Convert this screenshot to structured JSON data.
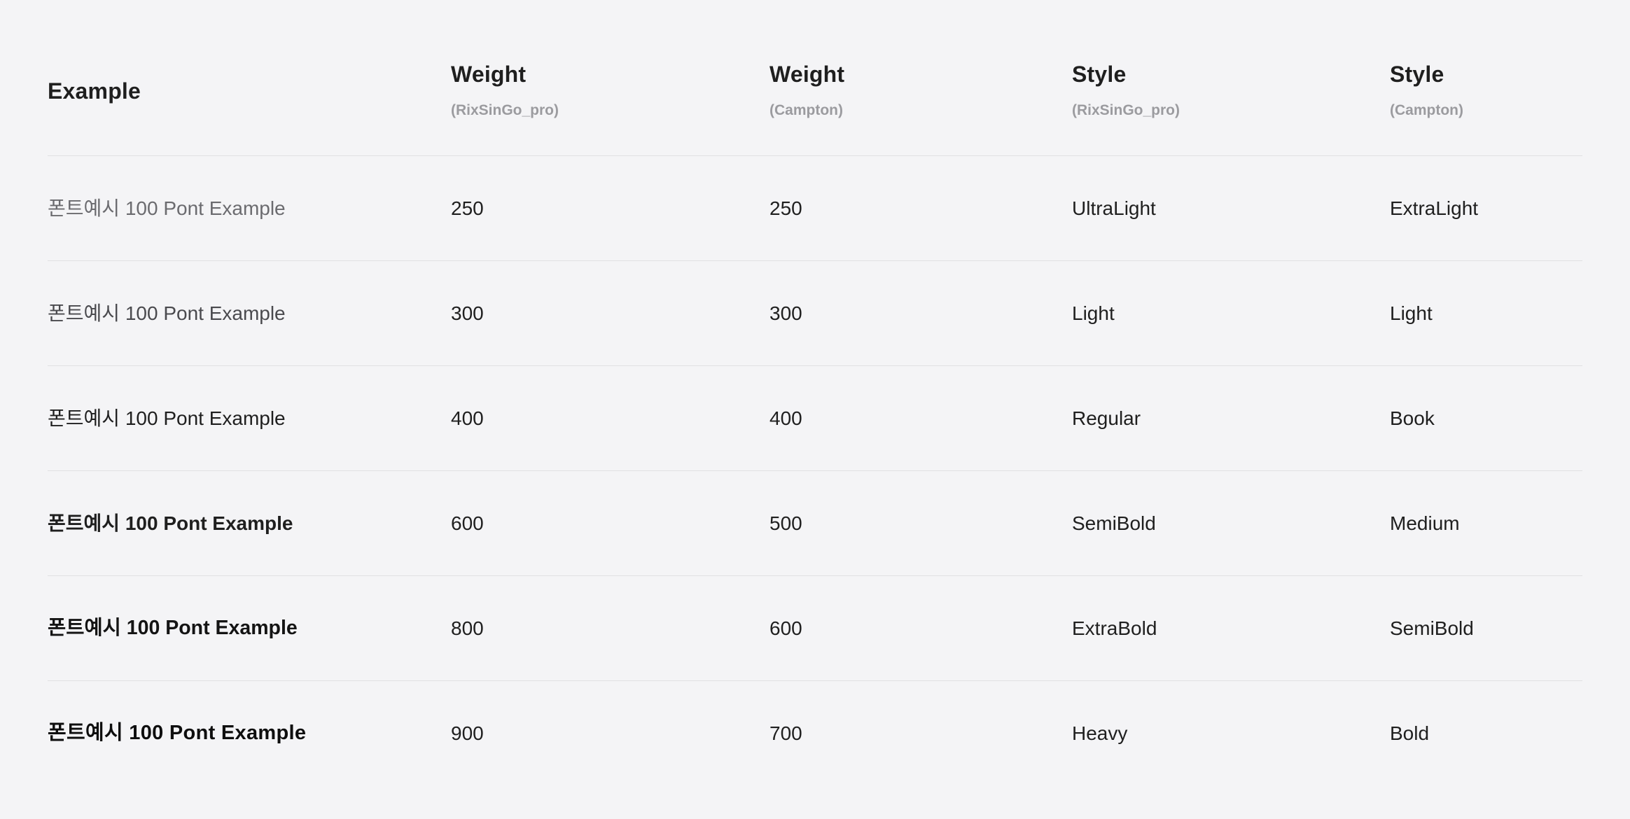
{
  "table": {
    "headers": [
      {
        "title": "Example",
        "subtitle": ""
      },
      {
        "title": "Weight",
        "subtitle": "(RixSinGo_pro)"
      },
      {
        "title": "Weight",
        "subtitle": "(Campton)"
      },
      {
        "title": "Style",
        "subtitle": "(RixSinGo_pro)"
      },
      {
        "title": "Style",
        "subtitle": "(Campton)"
      }
    ],
    "rows": [
      {
        "example": "폰트예시 100 Pont Example",
        "weight_rix": "250",
        "weight_campton": "250",
        "style_rix": "UltraLight",
        "style_campton": "ExtraLight"
      },
      {
        "example": "폰트예시 100 Pont Example",
        "weight_rix": "300",
        "weight_campton": "300",
        "style_rix": "Light",
        "style_campton": "Light"
      },
      {
        "example": "폰트예시 100 Pont Example",
        "weight_rix": "400",
        "weight_campton": "400",
        "style_rix": "Regular",
        "style_campton": "Book"
      },
      {
        "example": "폰트예시 100 Pont Example",
        "weight_rix": "600",
        "weight_campton": "500",
        "style_rix": "SemiBold",
        "style_campton": "Medium"
      },
      {
        "example": "폰트예시 100 Pont Example",
        "weight_rix": "800",
        "weight_campton": "600",
        "style_rix": "ExtraBold",
        "style_campton": "SemiBold"
      },
      {
        "example": "폰트예시 100 Pont Example",
        "weight_rix": "900",
        "weight_campton": "700",
        "style_rix": "Heavy",
        "style_campton": "Bold"
      }
    ]
  },
  "colors": {
    "background": "#f4f4f6",
    "text": "#1f1f1f",
    "subtitle": "#9b9b9f",
    "divider": "#e0e0e3"
  }
}
